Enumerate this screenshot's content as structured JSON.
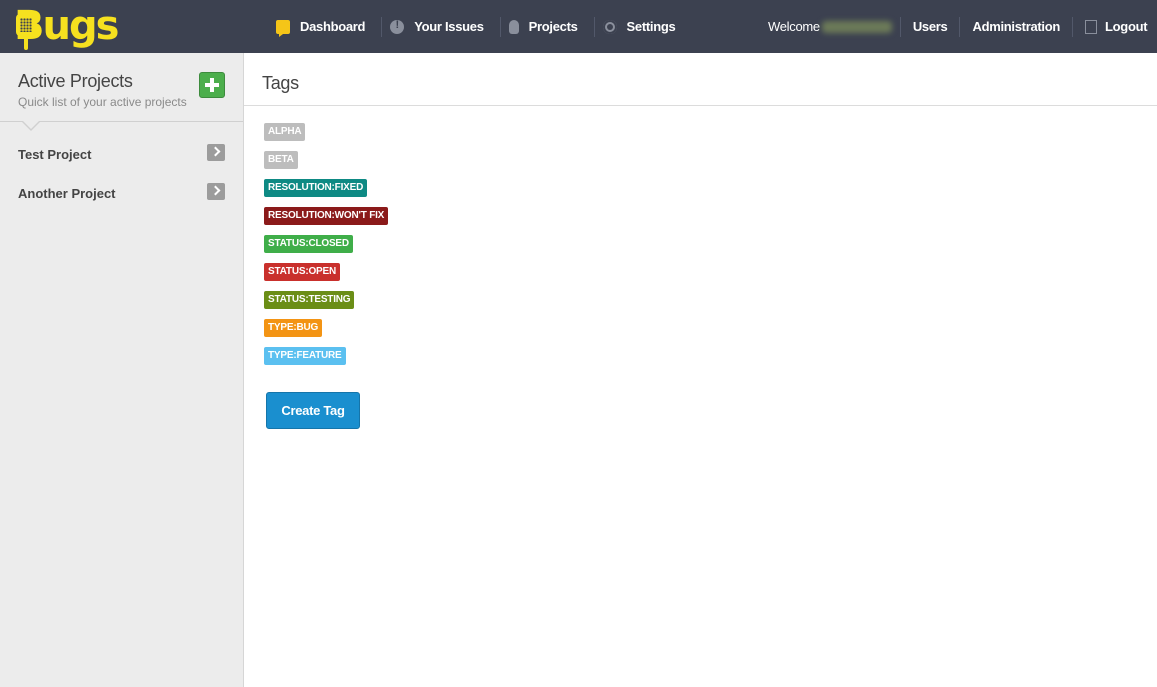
{
  "app": {
    "logo_text": "Bugs"
  },
  "nav": {
    "main": [
      {
        "label": "Dashboard",
        "icon": "chat-bubble-icon"
      },
      {
        "label": "Your Issues",
        "icon": "exclamation-icon"
      },
      {
        "label": "Projects",
        "icon": "lightbulb-icon"
      },
      {
        "label": "Settings",
        "icon": "gear-icon"
      }
    ],
    "welcome_label": "Welcome",
    "users_label": "Users",
    "administration_label": "Administration",
    "logout_label": "Logout"
  },
  "sidebar": {
    "title": "Active Projects",
    "subtitle": "Quick list of your active projects",
    "projects": [
      {
        "name": "Test Project"
      },
      {
        "name": "Another Project"
      }
    ]
  },
  "main": {
    "title": "Tags",
    "tags": [
      {
        "label": "ALPHA",
        "color": "#bdbdbd"
      },
      {
        "label": "BETA",
        "color": "#bdbdbd"
      },
      {
        "label": "RESOLUTION:FIXED",
        "color": "#0e8a84"
      },
      {
        "label": "RESOLUTION:WON'T FIX",
        "color": "#8b1a1a"
      },
      {
        "label": "STATUS:CLOSED",
        "color": "#3fae49"
      },
      {
        "label": "STATUS:OPEN",
        "color": "#c9302c"
      },
      {
        "label": "STATUS:TESTING",
        "color": "#6b8e16"
      },
      {
        "label": "TYPE:BUG",
        "color": "#f39414"
      },
      {
        "label": "TYPE:FEATURE",
        "color": "#5bc0f0"
      }
    ],
    "create_button_label": "Create Tag"
  },
  "colors": {
    "topbar": "#3c4150",
    "logo": "#f6e11f",
    "sidebar_bg": "#ececec",
    "add_button": "#4cae4c",
    "primary_button": "#1a8fcf"
  }
}
